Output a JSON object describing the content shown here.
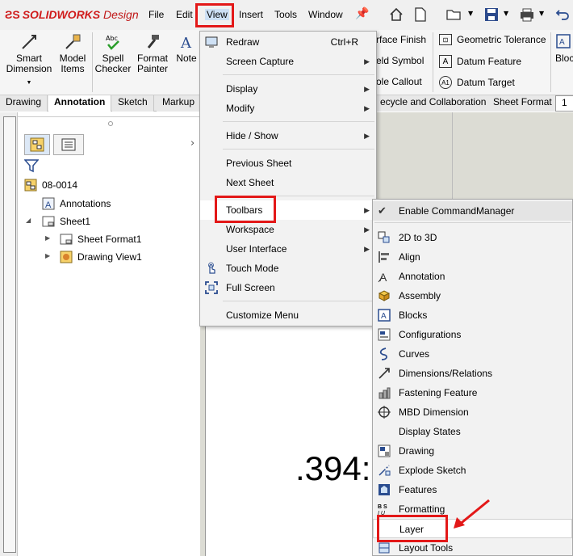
{
  "app": {
    "brand_prefix": "SOLIDWORKS",
    "brand_suffix": "Design"
  },
  "menubar": [
    "File",
    "Edit",
    "View",
    "Insert",
    "Tools",
    "Window"
  ],
  "ribbon": {
    "buttons": [
      {
        "label1": "Smart",
        "label2": "Dimension"
      },
      {
        "label1": "Model",
        "label2": "Items"
      },
      {
        "label1": "Spell",
        "label2": "Checker"
      },
      {
        "label1": "Format",
        "label2": "Painter"
      },
      {
        "label1": "Note",
        "label2": ""
      }
    ],
    "right_col1": [
      "rface Finish",
      "eld Symbol",
      "ole Callout"
    ],
    "right_col2": [
      "Geometric Tolerance",
      "Datum Feature",
      "Datum Target"
    ],
    "far_right": "Bloc"
  },
  "tabs": [
    "Drawing",
    "Annotation",
    "Sketch",
    "Markup",
    "ecycle and Collaboration",
    "Sheet Format",
    "1"
  ],
  "tree": {
    "root": "08-0014",
    "items": [
      "Annotations",
      "Sheet1",
      "Sheet Format1",
      "Drawing View1"
    ]
  },
  "canvas_text": ".394:",
  "view_menu": {
    "items": [
      {
        "label": "Redraw",
        "shortcut": "Ctrl+R"
      },
      {
        "label": "Screen Capture"
      },
      {
        "label": "Display"
      },
      {
        "label": "Modify"
      },
      {
        "label": "Hide / Show"
      },
      {
        "label": "Previous Sheet"
      },
      {
        "label": "Next Sheet"
      },
      {
        "label": "Toolbars"
      },
      {
        "label": "Workspace"
      },
      {
        "label": "User Interface"
      },
      {
        "label": "Touch Mode"
      },
      {
        "label": "Full Screen"
      },
      {
        "label": "Customize Menu"
      }
    ]
  },
  "toolbars_menu": {
    "items": [
      "Enable CommandManager",
      "2D to 3D",
      "Align",
      "Annotation",
      "Assembly",
      "Blocks",
      "Configurations",
      "Curves",
      "Dimensions/Relations",
      "Fastening Feature",
      "MBD Dimension",
      "Display States",
      "Drawing",
      "Explode Sketch",
      "Features",
      "Formatting",
      "Layer",
      "Layout Tools"
    ]
  },
  "colors": {
    "highlight_red": "#e31818",
    "brand_red": "#d01c1c"
  }
}
